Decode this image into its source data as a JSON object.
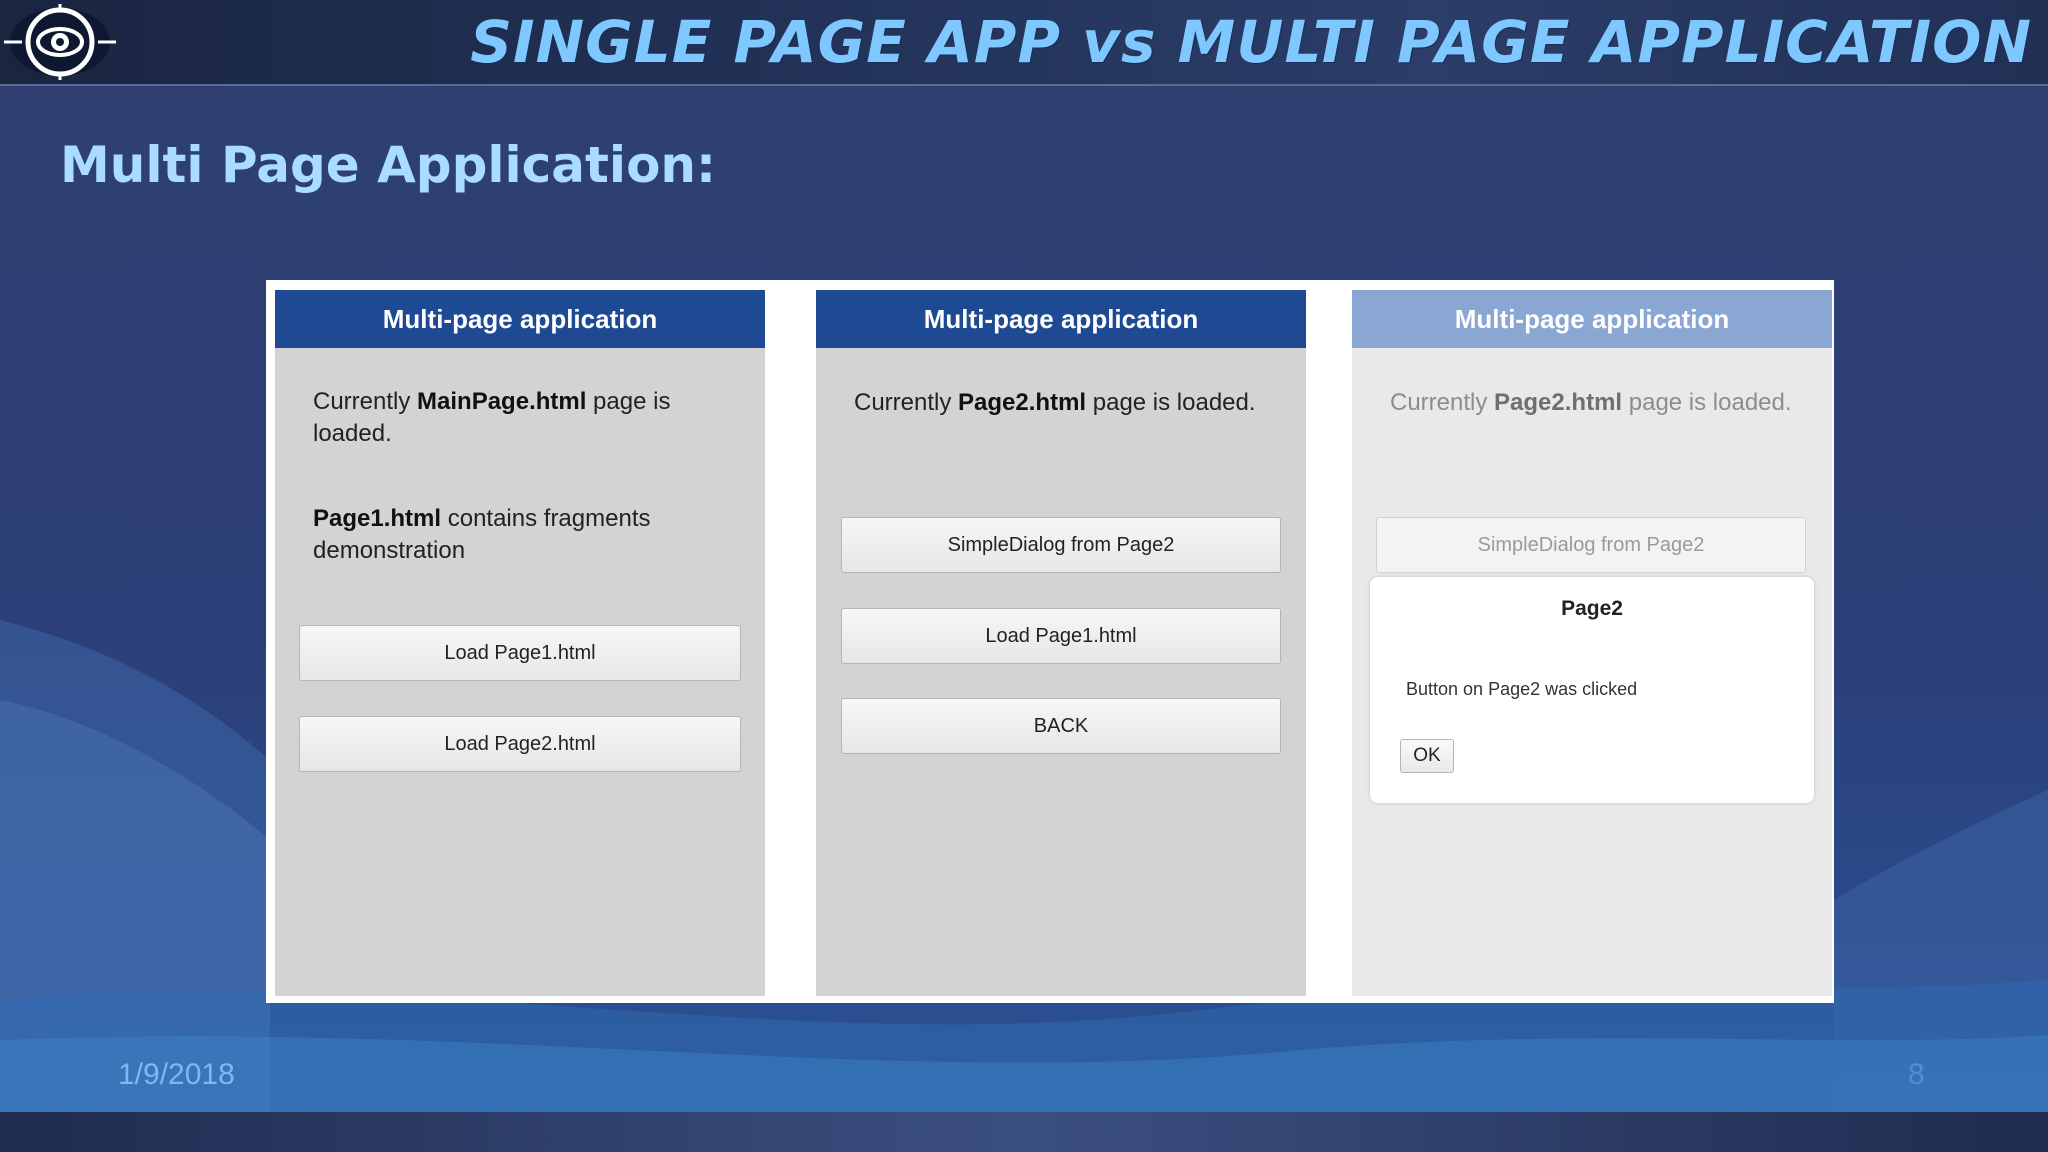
{
  "slide": {
    "title": "SINGLE PAGE APP vs MULTI PAGE APPLICATION",
    "subtitle": "Multi Page Application:",
    "date": "1/9/2018",
    "page_number": "8",
    "logo_icon": "eye-crosshair-logo"
  },
  "panels": [
    {
      "header": "Multi-page application",
      "text_prefix": "Currently ",
      "text_bold": "MainPage.html",
      "text_suffix": " page is loaded.",
      "text2_bold": "Page1.html",
      "text2_suffix": " contains fragments demonstration",
      "buttons": [
        "Load Page1.html",
        "Load Page2.html"
      ]
    },
    {
      "header": "Multi-page application",
      "text_prefix": "Currently ",
      "text_bold": "Page2.html",
      "text_suffix": " page is loaded.",
      "buttons": [
        "SimpleDialog from Page2",
        "Load Page1.html",
        "BACK"
      ]
    },
    {
      "header": "Multi-page application",
      "text_prefix": "Currently ",
      "text_bold": "Page2.html",
      "text_suffix": " page is loaded.",
      "buttons": [
        "SimpleDialog from Page2"
      ],
      "dialog": {
        "title": "Page2",
        "message": "Button on Page2 was clicked",
        "ok_label": "OK"
      }
    }
  ],
  "colors": {
    "panel_header": "#1e4a94",
    "title_text": "#7ec8ff",
    "subtitle_text": "#a9dcff"
  }
}
